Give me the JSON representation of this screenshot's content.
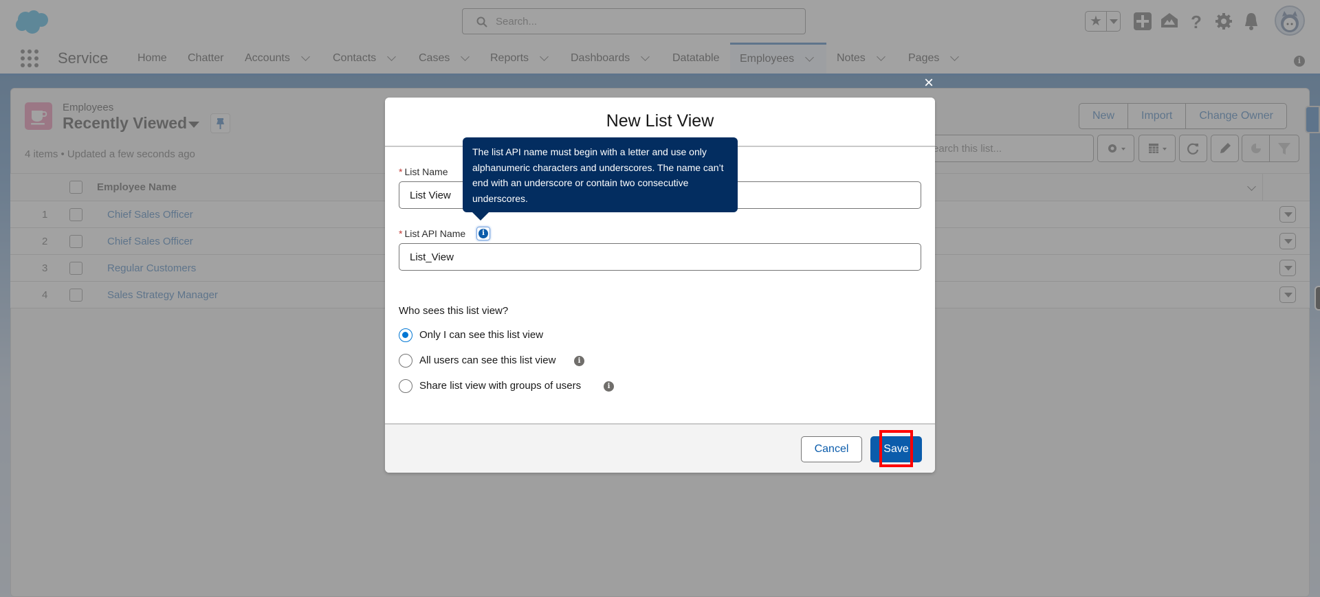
{
  "header": {
    "search_placeholder": "Search...",
    "icons": [
      "favorites-star-icon",
      "favorites-dropdown-icon",
      "global-create-icon",
      "trailhead-icon",
      "help-icon",
      "setup-gear-icon",
      "notifications-bell-icon",
      "user-avatar"
    ]
  },
  "nav": {
    "app_name": "Service",
    "tabs": [
      {
        "label": "Home",
        "dropdown": false
      },
      {
        "label": "Chatter",
        "dropdown": false
      },
      {
        "label": "Accounts",
        "dropdown": true
      },
      {
        "label": "Contacts",
        "dropdown": true
      },
      {
        "label": "Cases",
        "dropdown": true
      },
      {
        "label": "Reports",
        "dropdown": true
      },
      {
        "label": "Dashboards",
        "dropdown": true
      },
      {
        "label": "Datatable",
        "dropdown": false
      },
      {
        "label": "Employees",
        "dropdown": true,
        "active": true
      },
      {
        "label": "Notes",
        "dropdown": true
      },
      {
        "label": "Pages",
        "dropdown": true
      }
    ]
  },
  "list": {
    "object_label": "Employees",
    "view_name": "Recently Viewed",
    "meta": "4 items • Updated a few seconds ago",
    "actions": [
      "New",
      "Import",
      "Change Owner"
    ],
    "search_placeholder": "Search this list...",
    "column_header": "Employee Name",
    "rows": [
      {
        "num": "1",
        "name": "Chief Sales Officer"
      },
      {
        "num": "2",
        "name": "Chief Sales Officer"
      },
      {
        "num": "3",
        "name": "Regular Customers"
      },
      {
        "num": "4",
        "name": "Sales Strategy Manager"
      }
    ]
  },
  "modal": {
    "close": "×",
    "title": "New List View",
    "list_name_label": "List Name",
    "list_name_value": "List View",
    "api_name_label": "List API Name",
    "api_name_value": "List_View",
    "required_mark": "*",
    "tooltip": "The list API name must begin with a letter and use only alphanumeric characters and underscores. The name can’t end with an underscore or contain two consecutive underscores.",
    "visibility_question": "Who sees this list view?",
    "visibility_options": [
      {
        "label": "Only I can see this list view",
        "selected": true,
        "info": false
      },
      {
        "label": "All users can see this list view",
        "selected": false,
        "info": true
      },
      {
        "label": "Share list view with groups of users",
        "selected": false,
        "info": true
      }
    ],
    "cancel_label": "Cancel",
    "save_label": "Save"
  },
  "colors": {
    "brand": "#0b5cab",
    "tooltip_bg": "#032d60",
    "highlight": "#ff0000",
    "object_icon": "#e56798"
  }
}
